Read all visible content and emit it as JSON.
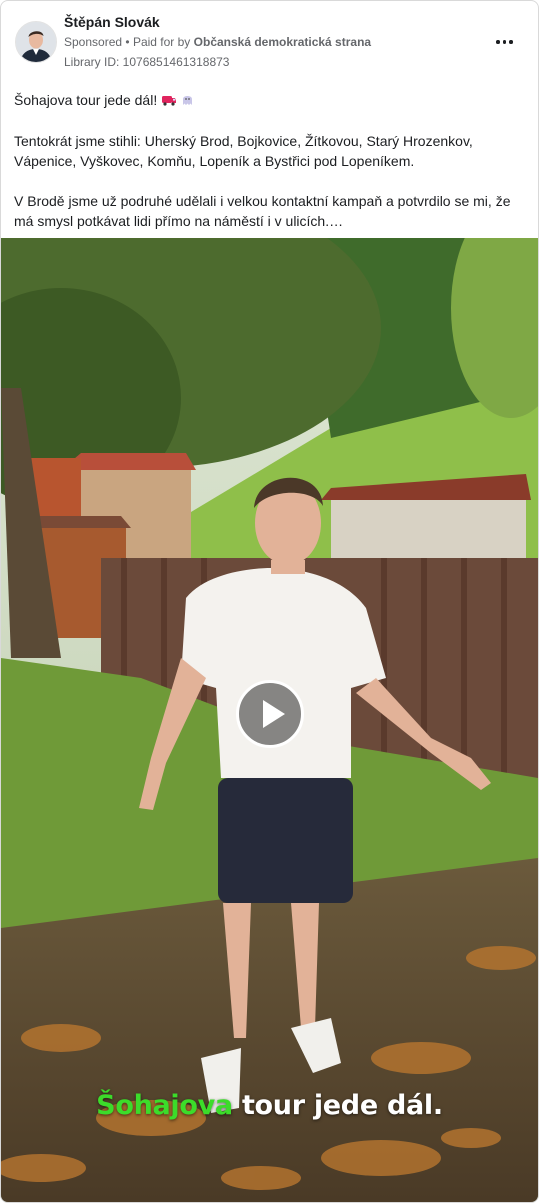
{
  "post": {
    "author": "Štěpán Slovák",
    "sponsored_label": "Sponsored",
    "separator": "•",
    "paid_for_prefix": "Paid for by",
    "paid_for_by": "Občanská demokratická strana",
    "library_id": "Library ID: 1076851461318873",
    "more_icon": "more-horizontal-icon"
  },
  "text": {
    "line1": "Šohajova tour jede dál!",
    "para2": "Tentokrát jsme stihli: Uherský Brod, Bojkovice, Žítkovou, Starý Hrozenkov, Vápenice, Vyškovec, Komňu, Lopeník a Bystřici pod Lopeníkem.",
    "para3": "V Brodě jsme už podruhé udělali i velkou kontaktní kampaň a potvrdilo se mi, že má smysl potkávat lidi přímo na náměstí i v ulicích.…"
  },
  "video": {
    "caption_highlight": "Šohajova",
    "caption_rest": " tour jede dál.",
    "play_icon": "play-icon",
    "caption_highlight_color": "#3cdc2a"
  }
}
